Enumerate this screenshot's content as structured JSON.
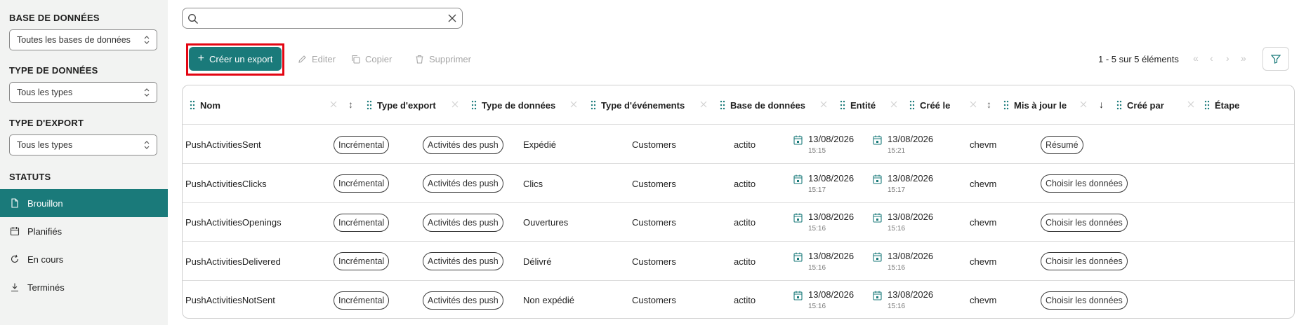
{
  "sidebar": {
    "database": {
      "heading": "BASE DE DONNÉES",
      "value": "Toutes les bases de données"
    },
    "data_type": {
      "heading": "TYPE DE DONNÉES",
      "value": "Tous les types"
    },
    "export_type": {
      "heading": "TYPE D'EXPORT",
      "value": "Tous les types"
    },
    "statuses": {
      "heading": "STATUTS",
      "items": [
        {
          "label": "Brouillon",
          "icon": "file-icon",
          "active": true
        },
        {
          "label": "Planifiés",
          "icon": "calendar-icon",
          "active": false
        },
        {
          "label": "En cours",
          "icon": "refresh-icon",
          "active": false
        },
        {
          "label": "Terminés",
          "icon": "download-icon",
          "active": false
        }
      ]
    }
  },
  "search": {
    "value": "",
    "placeholder": ""
  },
  "toolbar": {
    "create_label": "Créer un export",
    "edit_label": "Editer",
    "copy_label": "Copier",
    "delete_label": "Supprimer",
    "pagination": "1 - 5 sur 5 éléments"
  },
  "colors": {
    "accent": "#1a7a7a",
    "highlight_outline": "#e30613",
    "disabled": "#a6a6a6"
  },
  "table": {
    "columns": [
      {
        "key": "name",
        "label": "Nom"
      },
      {
        "key": "export_type",
        "label": "Type d'export"
      },
      {
        "key": "data_type",
        "label": "Type de données"
      },
      {
        "key": "event_type",
        "label": "Type d'événements"
      },
      {
        "key": "database",
        "label": "Base de données"
      },
      {
        "key": "entity",
        "label": "Entité"
      },
      {
        "key": "created",
        "label": "Créé le"
      },
      {
        "key": "updated",
        "label": "Mis à jour le"
      },
      {
        "key": "created_by",
        "label": "Créé par"
      },
      {
        "key": "stage",
        "label": "Étape"
      }
    ],
    "sort": {
      "column": "Mis à jour le",
      "direction": "descending"
    },
    "rows": [
      {
        "name": "PushActivitiesSent",
        "export_type": "Incrémental",
        "data_type": "Activités des push",
        "event_type": "Expédié",
        "database": "Customers",
        "entity": "actito",
        "created_date": "13/08/2026",
        "created_time": "15:15",
        "updated_date": "13/08/2026",
        "updated_time": "15:21",
        "created_by": "chevm",
        "stage": "Résumé"
      },
      {
        "name": "PushActivitiesClicks",
        "export_type": "Incrémental",
        "data_type": "Activités des push",
        "event_type": "Clics",
        "database": "Customers",
        "entity": "actito",
        "created_date": "13/08/2026",
        "created_time": "15:17",
        "updated_date": "13/08/2026",
        "updated_time": "15:17",
        "created_by": "chevm",
        "stage": "Choisir les données"
      },
      {
        "name": "PushActivitiesOpenings",
        "export_type": "Incrémental",
        "data_type": "Activités des push",
        "event_type": "Ouvertures",
        "database": "Customers",
        "entity": "actito",
        "created_date": "13/08/2026",
        "created_time": "15:16",
        "updated_date": "13/08/2026",
        "updated_time": "15:16",
        "created_by": "chevm",
        "stage": "Choisir les données"
      },
      {
        "name": "PushActivitiesDelivered",
        "export_type": "Incrémental",
        "data_type": "Activités des push",
        "event_type": "Délivré",
        "database": "Customers",
        "entity": "actito",
        "created_date": "13/08/2026",
        "created_time": "15:16",
        "updated_date": "13/08/2026",
        "updated_time": "15:16",
        "created_by": "chevm",
        "stage": "Choisir les données"
      },
      {
        "name": "PushActivitiesNotSent",
        "export_type": "Incrémental",
        "data_type": "Activités des push",
        "event_type": "Non expédié",
        "database": "Customers",
        "entity": "actito",
        "created_date": "13/08/2026",
        "created_time": "15:16",
        "updated_date": "13/08/2026",
        "updated_time": "15:16",
        "created_by": "chevm",
        "stage": "Choisir les données"
      }
    ]
  }
}
